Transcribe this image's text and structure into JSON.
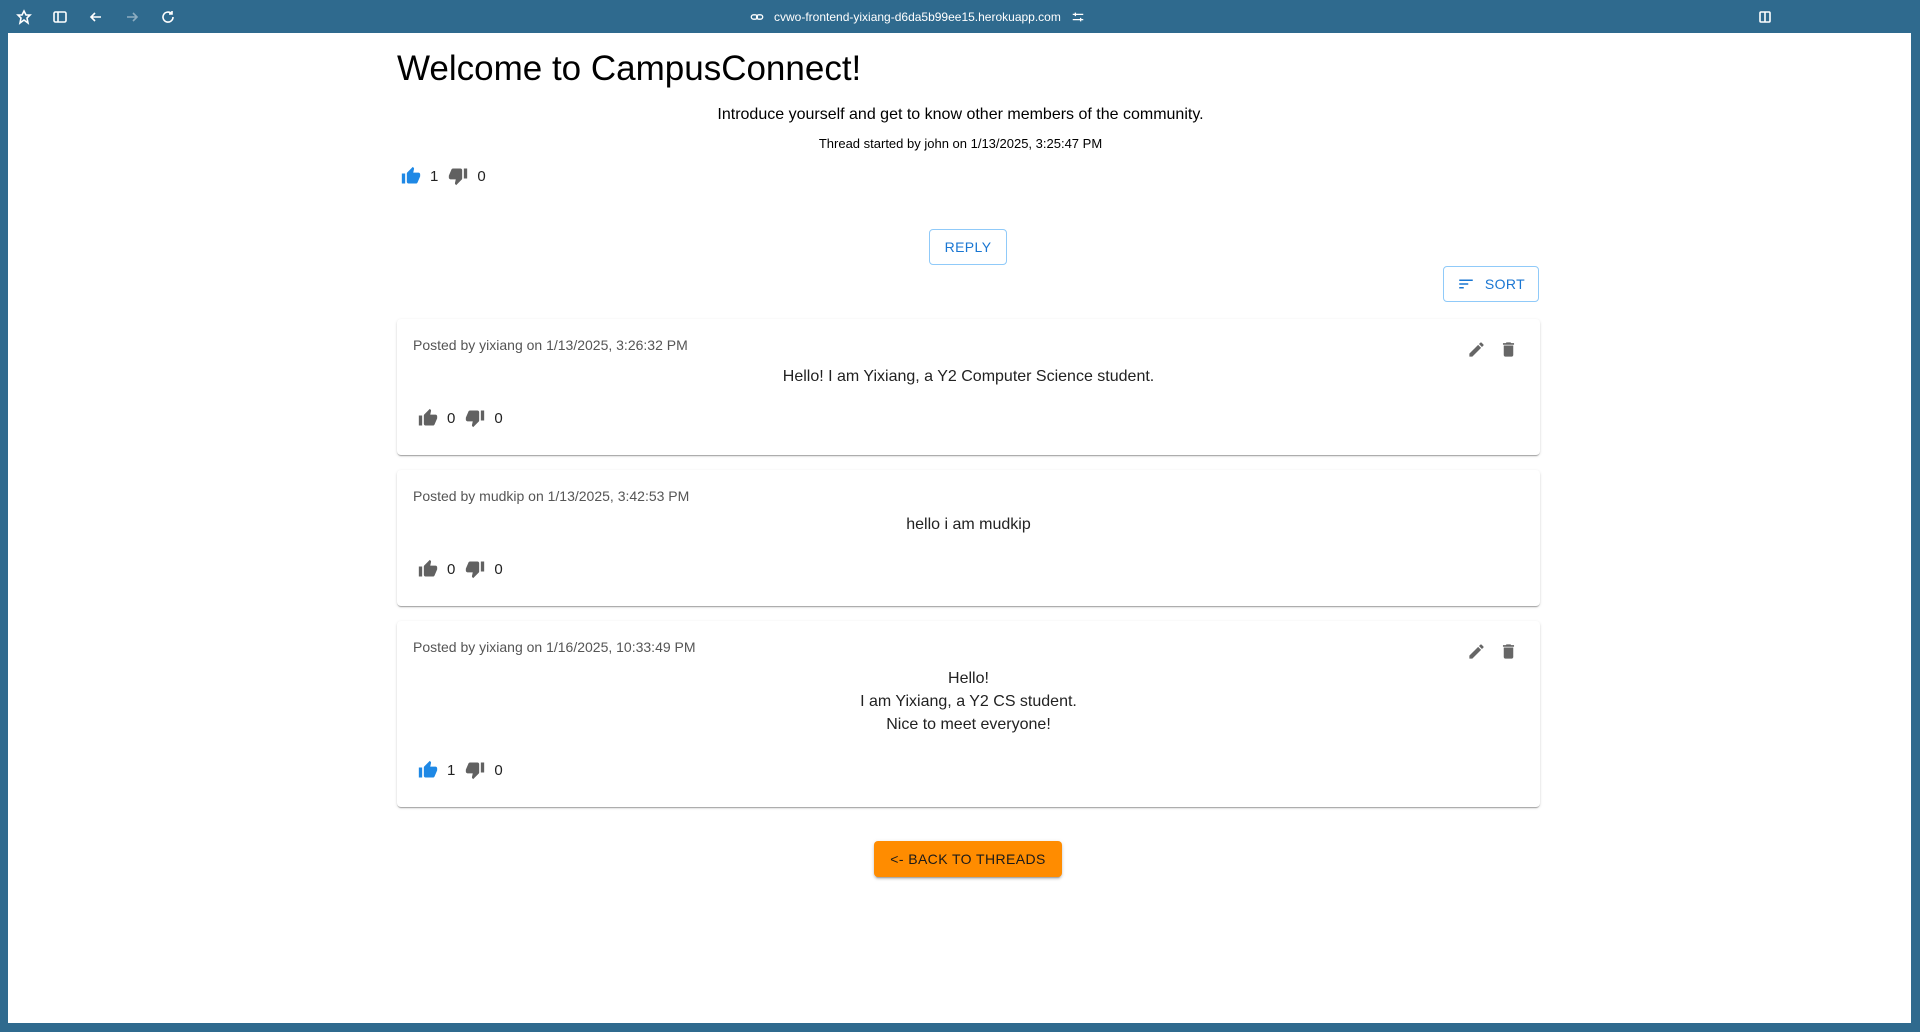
{
  "browser": {
    "url": "cvwo-frontend-yixiang-d6da5b99ee15.herokuapp.com"
  },
  "thread": {
    "title": "Welcome to CampusConnect!",
    "description": "Introduce yourself and get to know other members of the community.",
    "started": "Thread started by john on 1/13/2025, 3:25:47 PM",
    "likes": "1",
    "dislikes": "0",
    "liked": true
  },
  "controls": {
    "reply_label": "REPLY",
    "sort_label": "SORT",
    "back_label": "<- BACK TO THREADS"
  },
  "comments": [
    {
      "meta": "Posted by yixiang on 1/13/2025, 3:26:32 PM",
      "lines": [
        "Hello! I am Yixiang, a Y2 Computer Science student."
      ],
      "likes": "0",
      "dislikes": "0",
      "liked": false,
      "editable": true
    },
    {
      "meta": "Posted by mudkip on 1/13/2025, 3:42:53 PM",
      "lines": [
        "hello i am mudkip"
      ],
      "likes": "0",
      "dislikes": "0",
      "liked": false,
      "editable": false
    },
    {
      "meta": "Posted by yixiang on 1/16/2025, 10:33:49 PM",
      "lines": [
        "Hello!",
        "I am Yixiang, a Y2 CS student.",
        "Nice to meet everyone!"
      ],
      "likes": "1",
      "dislikes": "0",
      "liked": true,
      "editable": true
    }
  ],
  "colors": {
    "liked": "#1e88e5",
    "neutral": "#616161",
    "accent_orange": "#ff8c00",
    "primary": "#1976d2"
  }
}
